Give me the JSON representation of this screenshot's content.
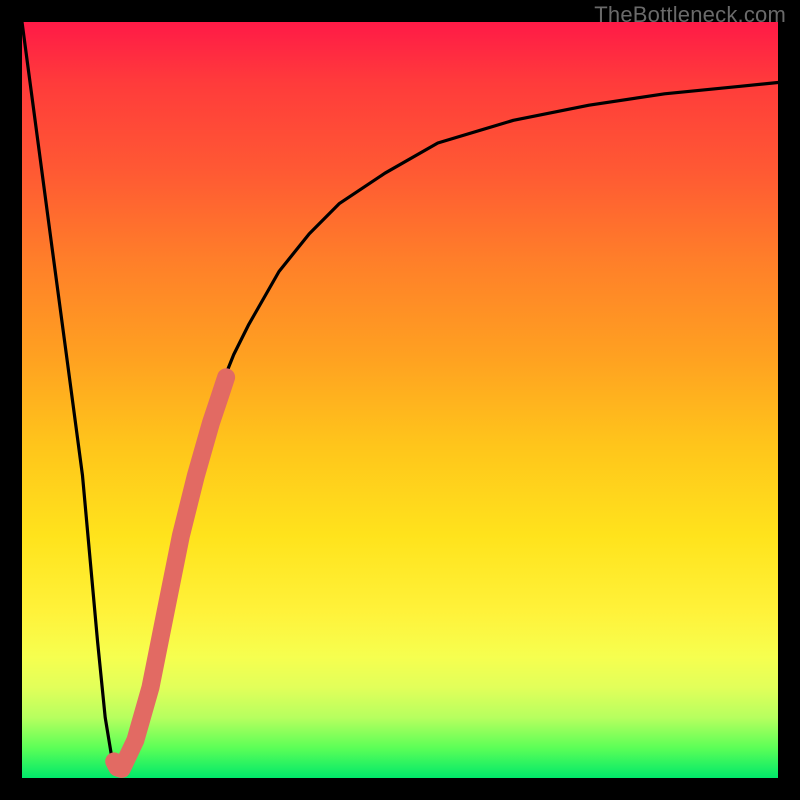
{
  "watermark": "TheBottleneck.com",
  "chart_data": {
    "type": "line",
    "title": "",
    "xlabel": "",
    "ylabel": "",
    "xlim": [
      0,
      100
    ],
    "ylim": [
      0,
      100
    ],
    "grid": false,
    "legend": false,
    "series": [
      {
        "name": "bottleneck-curve",
        "x": [
          0,
          2,
          4,
          6,
          8,
          10,
          11,
          12,
          13,
          14,
          16,
          18,
          20,
          22,
          24,
          26,
          28,
          30,
          34,
          38,
          42,
          48,
          55,
          65,
          75,
          85,
          95,
          100
        ],
        "y": [
          100,
          85,
          70,
          55,
          40,
          18,
          8,
          2,
          1,
          2,
          8,
          18,
          30,
          38,
          45,
          51,
          56,
          60,
          67,
          72,
          76,
          80,
          84,
          87,
          89,
          90.5,
          91.5,
          92
        ]
      }
    ],
    "highlight_segment": {
      "name": "overlay-marker",
      "color": "#e26a63",
      "x": [
        12.2,
        12.6,
        13.2,
        15,
        17,
        19,
        21,
        23,
        25,
        26,
        27
      ],
      "y": [
        2.2,
        1.4,
        1.2,
        5,
        12,
        22,
        32,
        40,
        47,
        50,
        53
      ]
    },
    "gradient_background": {
      "top": "#ff1a47",
      "middle": "#ffe31c",
      "bottom": "#00e86a"
    }
  }
}
